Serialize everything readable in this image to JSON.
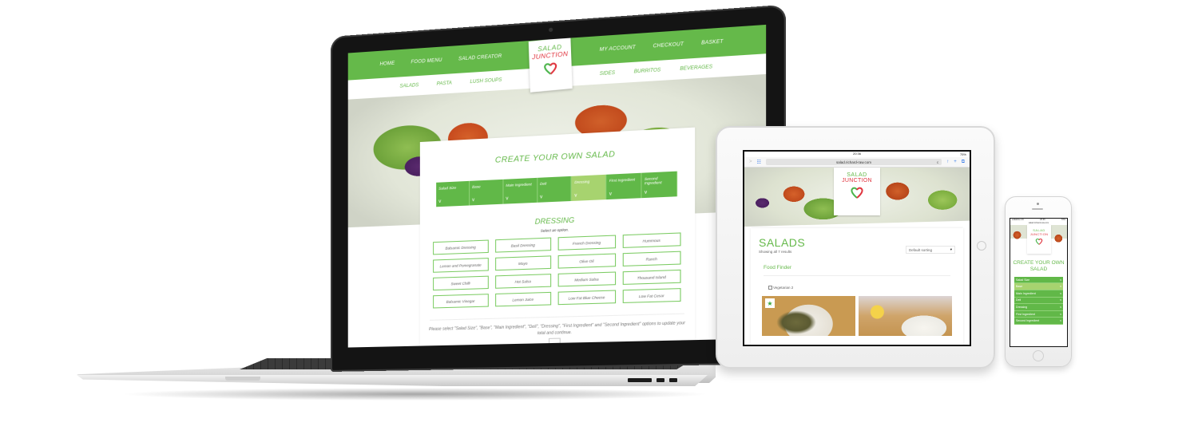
{
  "brand": {
    "name_line1": "SALAD",
    "name_line2": "JUNCTION",
    "primary_color": "#65b94a",
    "accent_color": "#e0343e",
    "active_step_color": "#a7d36f"
  },
  "laptop": {
    "nav_primary_left": [
      "HOME",
      "FOOD MENU",
      "SALAD CREATOR"
    ],
    "nav_primary_right": [
      "MY ACCOUNT",
      "CHECKOUT",
      "BASKET"
    ],
    "nav_secondary_left": [
      "SALADS",
      "PASTA",
      "LUSH SOUPS"
    ],
    "nav_secondary_right": [
      "SIDES",
      "BURRITOS",
      "BEVERAGES"
    ],
    "creator_title": "CREATE YOUR OWN SALAD",
    "steps": [
      {
        "label": "Salad Size",
        "active": false
      },
      {
        "label": "Base",
        "active": false
      },
      {
        "label": "Main Ingredient",
        "active": false
      },
      {
        "label": "Deli",
        "active": false
      },
      {
        "label": "Dressing",
        "active": true
      },
      {
        "label": "First Ingredient",
        "active": false
      },
      {
        "label": "Second Ingredient",
        "active": false
      }
    ],
    "step_chevron": "v",
    "section_title": "DRESSING",
    "section_subtitle": "Select an option.",
    "options": [
      "Balsamic Dressing",
      "Basil Dressing",
      "French Dressing",
      "Hummous",
      "Lemon and Pomegranate",
      "Mayo",
      "Olive Oil",
      "Ranch",
      "Sweet Chilli",
      "Hot Salsa",
      "Medium Salsa",
      "Thousand Island",
      "Balsamic Vinegar",
      "Lemon Juice",
      "Low Fat Blue Cheese",
      "Low Fat Cesar"
    ],
    "notice": "Please select \"Salad Size\", \"Base\", \"Main Ingredient\", \"Deli\", \"Dressing\", \"First Ingredient\" and \"Second Ingredient\" options to update your total and continue."
  },
  "tablet": {
    "status_time": "20:36",
    "status_battery": "75%",
    "url": "salad.richard-raw.com",
    "icons": [
      "back-icon",
      "bookmarks-icon",
      "reload-icon",
      "share-icon",
      "add-icon",
      "tabs-icon"
    ],
    "back_glyph": ">",
    "bookmarks_glyph": "☷",
    "reload_glyph": "c",
    "share_glyph": "↑",
    "add_glyph": "+",
    "tabs_glyph": "⧉",
    "page_title": "SALADS",
    "result_count": "Showing all 7 results",
    "sort_label": "Default sorting",
    "sort_arrow": "▾",
    "food_finder": "Food Finder",
    "filter_label": "Vegetarian 2",
    "featured_badge": "★"
  },
  "phone": {
    "status_carrier": "vodafone UK",
    "status_time": "20:36",
    "status_battery": "70%",
    "url": "salad.richard-raw.com",
    "title": "CREATE YOUR OWN SALAD",
    "steps": [
      {
        "label": "Salad Size",
        "active": false
      },
      {
        "label": "Base",
        "active": true
      },
      {
        "label": "Main Ingredient",
        "active": false
      },
      {
        "label": "Deli",
        "active": false
      },
      {
        "label": "Dressing",
        "active": false
      },
      {
        "label": "First Ingredient",
        "active": false
      },
      {
        "label": "Second Ingredient",
        "active": false
      }
    ],
    "step_chevron": "v"
  }
}
